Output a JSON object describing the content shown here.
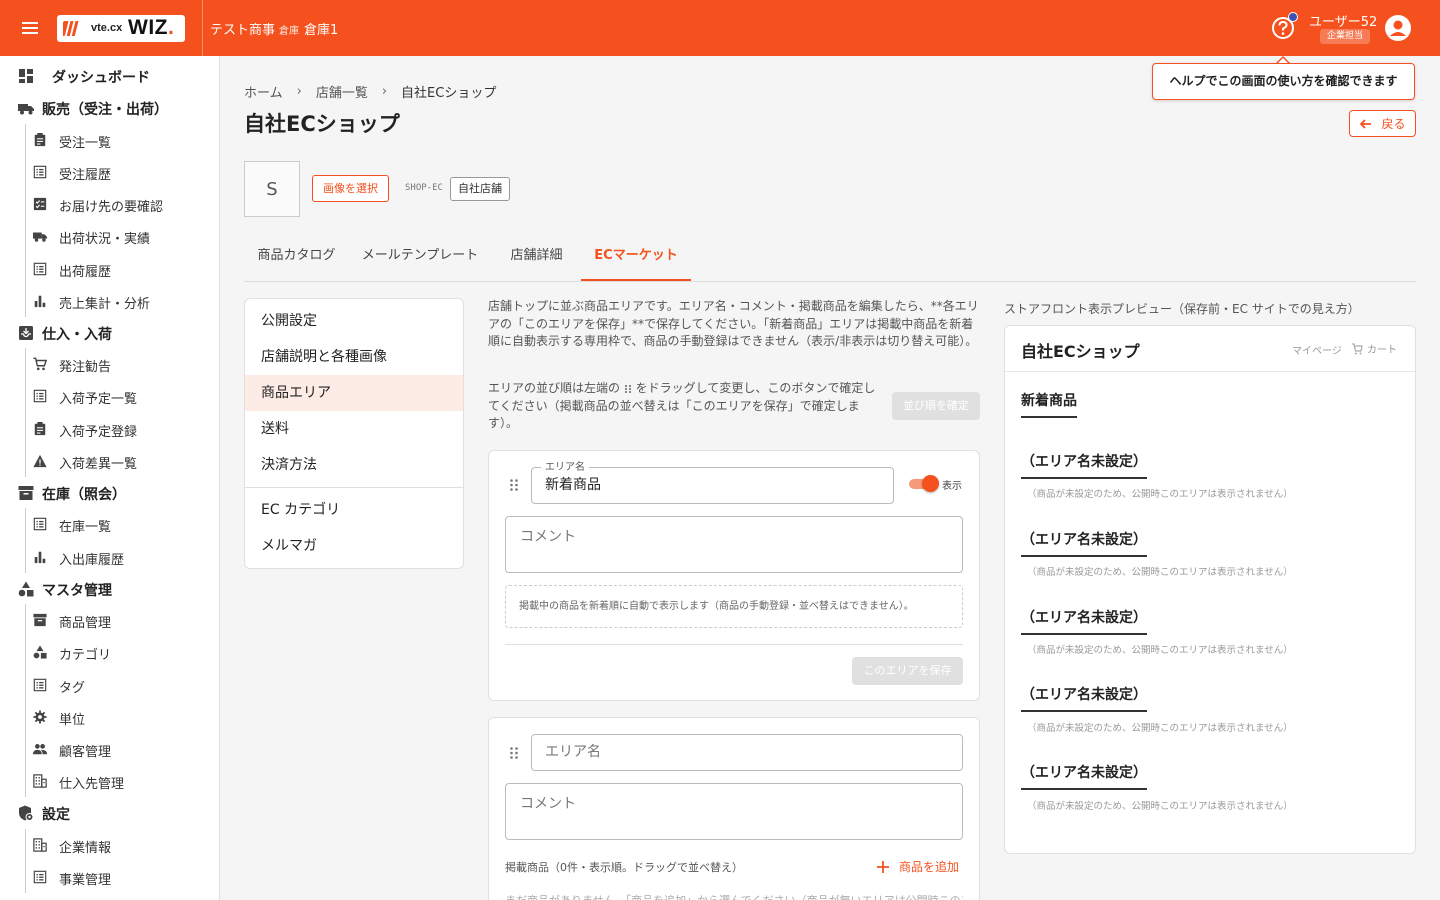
{
  "header": {
    "logo_small": "vte.cx",
    "logo_big": "WIZ",
    "logo_dot": ".",
    "company": "テスト商事",
    "warehouse_label": "倉庫",
    "warehouse": "倉庫1",
    "user_name": "ユーザー52",
    "user_role": "企業担当",
    "accent": "#f4511e"
  },
  "tooltip": "ヘルプでこの画面の使い方を確認できます",
  "sidebar": {
    "items": [
      {
        "label": "ダッシュボード",
        "icon": "dashboard-icon",
        "level": 0
      },
      {
        "label": "販売（受注・出荷）",
        "icon": "truck-icon",
        "level": 0
      },
      {
        "label": "受注一覧",
        "icon": "clipboard-icon",
        "level": 1
      },
      {
        "label": "受注履歴",
        "icon": "list-icon",
        "level": 1
      },
      {
        "label": "お届け先の要確認",
        "icon": "checklist-icon",
        "level": 1
      },
      {
        "label": "出荷状況・実績",
        "icon": "truck-icon",
        "level": 1
      },
      {
        "label": "出荷履歴",
        "icon": "list-icon",
        "level": 1
      },
      {
        "label": "売上集計・分析",
        "icon": "bar-chart-icon",
        "level": 1
      },
      {
        "label": "仕入・入荷",
        "icon": "inbox-icon",
        "level": 0
      },
      {
        "label": "発注勧告",
        "icon": "cart-icon",
        "level": 1
      },
      {
        "label": "入荷予定一覧",
        "icon": "list-icon",
        "level": 1
      },
      {
        "label": "入荷予定登録",
        "icon": "clipboard-icon",
        "level": 1
      },
      {
        "label": "入荷差異一覧",
        "icon": "warning-icon",
        "level": 1
      },
      {
        "label": "在庫（照会）",
        "icon": "archive-icon",
        "level": 0
      },
      {
        "label": "在庫一覧",
        "icon": "list-icon",
        "level": 1
      },
      {
        "label": "入出庫履歴",
        "icon": "bar-chart-icon",
        "level": 1
      },
      {
        "label": "マスタ管理",
        "icon": "shapes-icon",
        "level": 0
      },
      {
        "label": "商品管理",
        "icon": "archive-icon",
        "level": 1
      },
      {
        "label": "カテゴリ",
        "icon": "shapes-icon",
        "level": 1
      },
      {
        "label": "タグ",
        "icon": "list-icon",
        "level": 1
      },
      {
        "label": "単位",
        "icon": "gear-icon",
        "level": 1
      },
      {
        "label": "顧客管理",
        "icon": "people-icon",
        "level": 1
      },
      {
        "label": "仕入先管理",
        "icon": "building-icon",
        "level": 1
      },
      {
        "label": "設定",
        "icon": "settings-shield-icon",
        "level": 0
      },
      {
        "label": "企業情報",
        "icon": "building-icon",
        "level": 1
      },
      {
        "label": "事業管理",
        "icon": "list-icon",
        "level": 1
      }
    ]
  },
  "breadcrumb": {
    "home": "ホーム",
    "shops": "店舗一覧",
    "current": "自社ECショップ",
    "sep": "›"
  },
  "page_title": "自社ECショップ",
  "back_label": "戻る",
  "shop": {
    "initial": "S",
    "select_image": "画像を選択",
    "code": "SHOP-EC",
    "badge": "自社店舗"
  },
  "tabs": [
    "商品カタログ",
    "メールテンプレート",
    "店舗詳細",
    "ECマーケット"
  ],
  "active_tab": "ECマーケット",
  "menu": [
    "公開設定",
    "店舗説明と各種画像",
    "商品エリア",
    "送料",
    "決済方法",
    "EC カテゴリ",
    "メルマガ"
  ],
  "active_menu": "商品エリア",
  "description": "店舗トップに並ぶ商品エリアです。エリア名・コメント・掲載商品を編集したら、**各エリアの「このエリアを保存」**で保存してください。「新着商品」エリアは掲載中商品を新着順に自動表示する専用枠で、商品の手動登録はできません（表示/非表示は切り替え可能）。",
  "order_note_pre": "エリアの並び順は左端の",
  "order_note_post": "をドラッグして変更し、このボタンで確定してください（掲載商品の並べ替えは「このエリアを保存」で確定します）。",
  "confirm_order_label": "並び順を確定",
  "area1": {
    "name_label": "エリア名",
    "name_value": "新着商品",
    "toggle_label": "表示",
    "toggle_on": true,
    "comment_placeholder": "コメント",
    "auto_note": "掲載中の商品を新着順に自動で表示します（商品の手動登録・並べ替えはできません）。",
    "save_label": "このエリアを保存"
  },
  "area2": {
    "name_placeholder": "エリア名",
    "comment_placeholder": "コメント",
    "products_label": "掲載商品（0件・表示順。ドラッグで並べ替え）",
    "add_product": "商品を追加",
    "empty_msg": "まだ商品がありません。「商品を追加」から選んでください（商品が無いエリアは公開時このエリ"
  },
  "preview": {
    "caption": "ストアフロント表示プレビュー（保存前・EC サイトでの見え方）",
    "shop_name": "自社ECショップ",
    "mypage": "マイページ",
    "cart": "カート",
    "sections": [
      {
        "title": "新着商品",
        "note": ""
      },
      {
        "title": "（エリア名未設定）",
        "note": "（商品が未設定のため、公開時このエリアは表示されません）"
      },
      {
        "title": "（エリア名未設定）",
        "note": "（商品が未設定のため、公開時このエリアは表示されません）"
      },
      {
        "title": "（エリア名未設定）",
        "note": "（商品が未設定のため、公開時このエリアは表示されません）"
      },
      {
        "title": "（エリア名未設定）",
        "note": "（商品が未設定のため、公開時このエリアは表示されません）"
      },
      {
        "title": "（エリア名未設定）",
        "note": "（商品が未設定のため、公開時このエリアは表示されません）"
      }
    ]
  }
}
